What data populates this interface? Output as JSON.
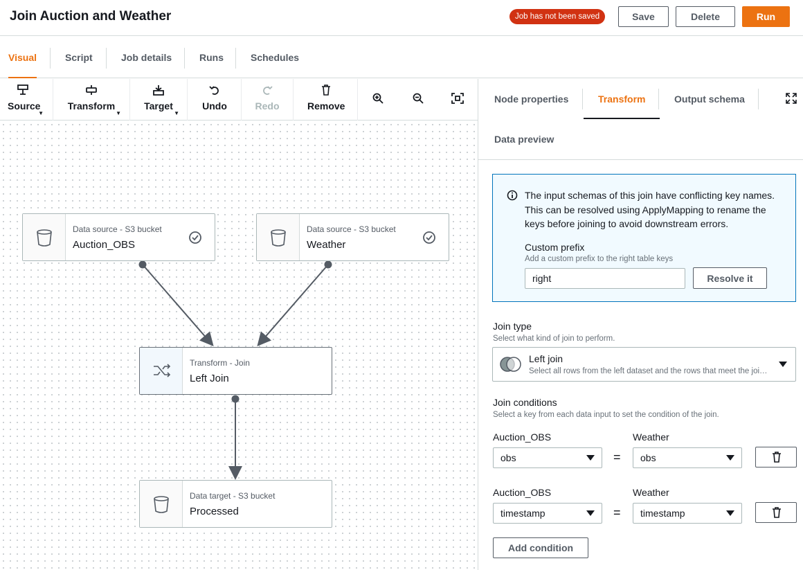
{
  "header": {
    "title": "Join Auction and Weather",
    "status_badge": "Job has not been saved",
    "save_label": "Save",
    "delete_label": "Delete",
    "run_label": "Run"
  },
  "tabs": [
    "Visual",
    "Script",
    "Job details",
    "Runs",
    "Schedules"
  ],
  "toolbar": {
    "source": "Source",
    "transform": "Transform",
    "target": "Target",
    "undo": "Undo",
    "redo": "Redo",
    "remove": "Remove"
  },
  "nodes": {
    "auction": {
      "type": "Data source - S3 bucket",
      "name": "Auction_OBS"
    },
    "weather": {
      "type": "Data source - S3 bucket",
      "name": "Weather"
    },
    "join": {
      "type": "Transform - Join",
      "name": "Left Join"
    },
    "target": {
      "type": "Data target - S3 bucket",
      "name": "Processed"
    }
  },
  "panel": {
    "tabs": [
      "Node properties",
      "Transform",
      "Output schema",
      "Data preview"
    ],
    "info": {
      "text": "The input schemas of this join have conflicting key names. This can be resolved using ApplyMapping to rename the keys before joining to avoid downstream errors.",
      "custom_prefix_label": "Custom prefix",
      "custom_prefix_desc": "Add a custom prefix to the right table keys",
      "custom_prefix_value": "right",
      "resolve_label": "Resolve it"
    },
    "join_type": {
      "label": "Join type",
      "desc": "Select what kind of join to perform.",
      "value": "Left join",
      "value_desc": "Select all rows from the left dataset and the rows that meet the join condition from the right dataset."
    },
    "join_conditions": {
      "label": "Join conditions",
      "desc": "Select a key from each data input to set the condition of the join.",
      "left_header": "Auction_OBS",
      "right_header": "Weather",
      "rows": [
        {
          "left": "obs",
          "right": "obs"
        },
        {
          "left": "timestamp",
          "right": "timestamp"
        }
      ],
      "eq": "=",
      "add_label": "Add condition"
    }
  },
  "colors": {
    "accent": "#ec7211",
    "badge": "#d13212",
    "info_border": "#0073bb",
    "info_bg": "#f1faff"
  }
}
